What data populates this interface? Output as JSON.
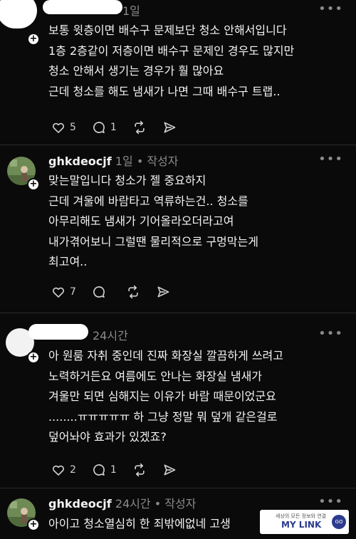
{
  "posts": [
    {
      "username": "",
      "time": "1일",
      "author_tag": "",
      "lines": [
        "보통 윗층이면 배수구 문제보단 청소 안해서입니다",
        "1층 2층같이 저층이면 배수구 문제인 경우도 많지만",
        "청소 안해서 생기는 경우가 훨 많아요",
        "근데 청소를 해도 냄새가 나면 그때 배수구 트랩.."
      ],
      "likes": "5",
      "replies": "1"
    },
    {
      "username": "ghkdeocjf",
      "time": "1일",
      "author_tag": "• 작성자",
      "lines": [
        "맞는말입니다 청소가 젤 중요하지",
        "근데 겨울에 바람타고 역류하는건.. 청소를",
        "아무리해도 냄새가 기어올라오더라고여",
        "내가겪어보니 그럴땐 물리적으로 구멍막는게",
        "최고여.."
      ],
      "likes": "7",
      "replies": ""
    },
    {
      "username": "",
      "time": "24시간",
      "author_tag": "",
      "lines": [
        "아 원룸 자취 중인데 진짜 화장실 깔끔하게 쓰려고",
        "노력하거든요 여름에도 안나는 화장실 냄새가",
        "겨울만 되면 심해지는 이유가 바람 때문이었군요",
        "........ㅠㅠㅠㅠㅠ 하 그냥 정말 뭐 덮개 같은걸로",
        "덮어놔야 효과가 있겠죠?"
      ],
      "likes": "2",
      "replies": "1"
    },
    {
      "username": "ghkdeocjf",
      "time": "24시간",
      "author_tag": "• 작성자",
      "lines": [
        "아이고 청소열심히 한 죄밖에없네 고생"
      ],
      "likes": "",
      "replies": ""
    }
  ],
  "more_icon": "•••",
  "watermark": {
    "tagline": "세상의 모든 정보와 연결",
    "brand": "MY LINK",
    "badge": "GO"
  },
  "colors": {
    "background": "#0a0a0a",
    "text": "#f3f3f3",
    "meta": "#8a8a8a",
    "divider": "#2a2a2a"
  }
}
